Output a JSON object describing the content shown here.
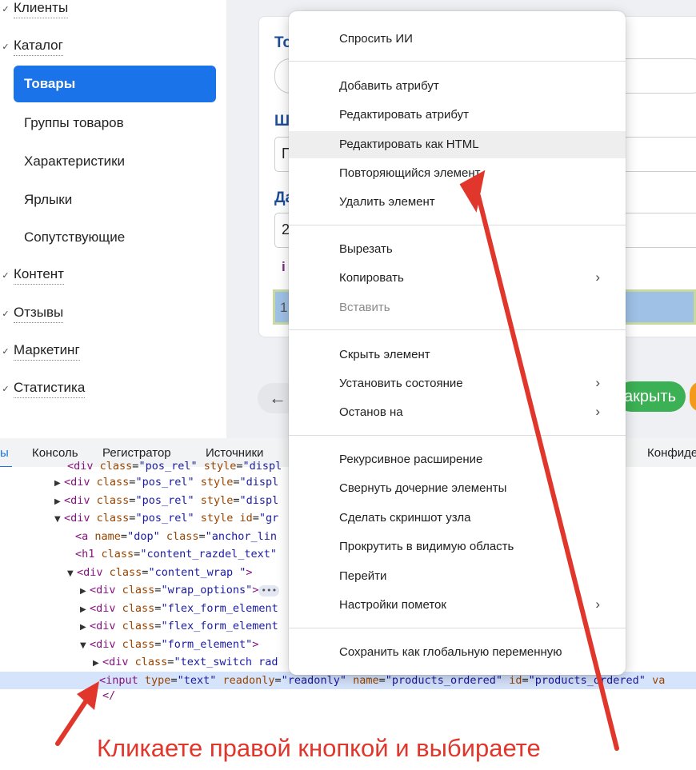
{
  "sidebar": {
    "groups": [
      {
        "label": "Клиенты"
      },
      {
        "label": "Каталог"
      },
      {
        "label": "Контент"
      },
      {
        "label": "Отзывы"
      },
      {
        "label": "Маркетинг"
      },
      {
        "label": "Статистика"
      }
    ],
    "catalog_items": [
      {
        "label": "Товары",
        "active": true
      },
      {
        "label": "Группы товаров"
      },
      {
        "label": "Характеристики"
      },
      {
        "label": "Ярлыки"
      },
      {
        "label": "Сопутствующие"
      }
    ]
  },
  "form": {
    "label_1": "То",
    "label_2": "Ш",
    "field_2_value": "П",
    "label_3": "Да",
    "field_3_value": "2",
    "inline_fragment": "i",
    "highlighted_value": "1",
    "close_button_label": "акрыть",
    "back_icon": "arrow-left-icon"
  },
  "devtools": {
    "tabs": [
      {
        "label": "ы",
        "active": true
      },
      {
        "label": "Консоль"
      },
      {
        "label": "Регистратор"
      },
      {
        "label": "Источники"
      },
      {
        "label": "Конфиде"
      }
    ]
  },
  "context_menu": {
    "items": [
      {
        "label": "Спросить ИИ"
      },
      {
        "label": "Добавить атрибут"
      },
      {
        "label": "Редактировать атрибут"
      },
      {
        "label": "Редактировать как HTML",
        "hover": true
      },
      {
        "label": "Повторяющийся элемент"
      },
      {
        "label": "Удалить элемент"
      },
      {
        "label": "Вырезать"
      },
      {
        "label": "Копировать",
        "submenu": true
      },
      {
        "label": "Вставить",
        "disabled": true
      },
      {
        "label": "Скрыть элемент"
      },
      {
        "label": "Установить состояние",
        "submenu": true
      },
      {
        "label": "Останов на",
        "submenu": true
      },
      {
        "label": "Рекурсивное расширение"
      },
      {
        "label": "Свернуть дочерние элементы"
      },
      {
        "label": "Сделать скриншот узла"
      },
      {
        "label": "Прокрутить в видимую область"
      },
      {
        "label": "Перейти"
      },
      {
        "label": "Настройки пометок",
        "submenu": true
      },
      {
        "label": "Сохранить как глобальную переменную"
      }
    ]
  },
  "annotation": {
    "caption": "Кликаете правой кнопкой и выбираете",
    "color": "#e0362b"
  },
  "colors": {
    "accent": "#1a73e8",
    "heading": "#1d4e99",
    "success": "#3cb054",
    "warning": "#f39a1a"
  }
}
